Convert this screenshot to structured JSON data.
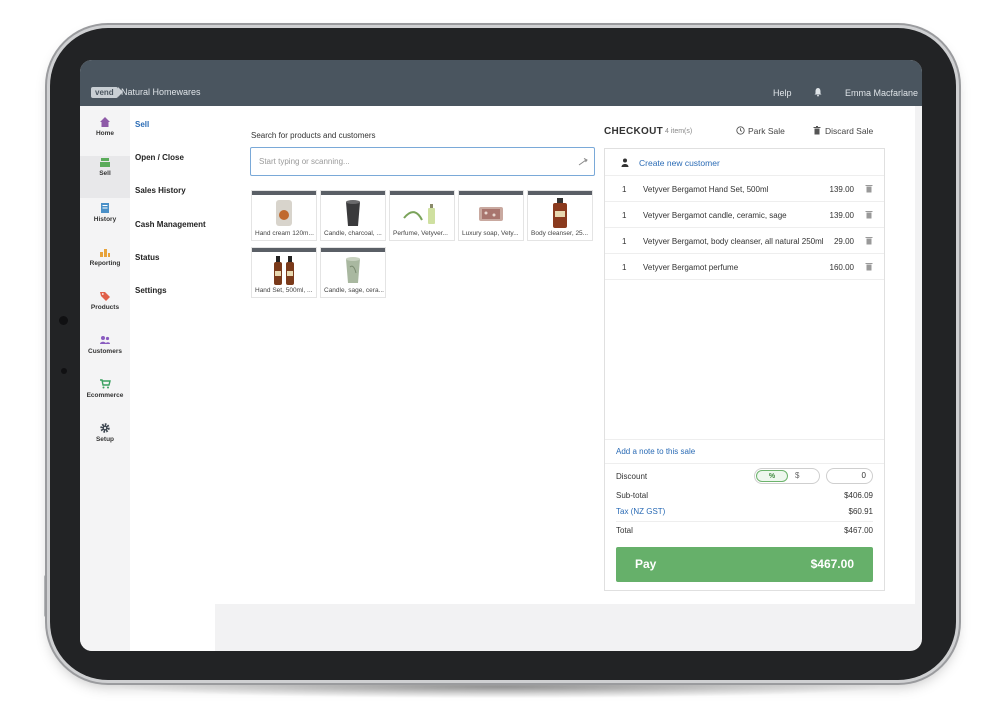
{
  "topbar": {
    "logo": "vend",
    "store_name": "Natural Homewares",
    "help": "Help",
    "user": "Emma Macfarlane"
  },
  "nav": [
    {
      "label": "Home",
      "icon": "home-icon"
    },
    {
      "label": "Sell",
      "icon": "register-icon"
    },
    {
      "label": "History",
      "icon": "history-icon"
    },
    {
      "label": "Reporting",
      "icon": "reporting-icon"
    },
    {
      "label": "Products",
      "icon": "tag-icon"
    },
    {
      "label": "Customers",
      "icon": "customers-icon"
    },
    {
      "label": "Ecommerce",
      "icon": "cart-icon"
    },
    {
      "label": "Setup",
      "icon": "gear-icon"
    }
  ],
  "subnav": [
    "Sell",
    "Open / Close",
    "Sales History",
    "Cash Management",
    "Status",
    "Settings"
  ],
  "search": {
    "label": "Search for products and customers",
    "placeholder": "Start typing or scanning..."
  },
  "products": [
    {
      "name": "Hand cream 120m..."
    },
    {
      "name": "Candle, charcoal, ..."
    },
    {
      "name": "Perfume, Vetyver..."
    },
    {
      "name": "Luxury soap, Vety..."
    },
    {
      "name": "Body cleanser, 25..."
    },
    {
      "name": "Hand Set, 500ml, ..."
    },
    {
      "name": "Candle, sage, cera..."
    }
  ],
  "checkout": {
    "title": "CHECKOUT",
    "item_count": "4 item(s)",
    "park": "Park Sale",
    "discard": "Discard Sale",
    "create_customer": "Create new customer",
    "lines": [
      {
        "qty": "1",
        "name": "Vetyver Bergamot Hand Set, 500ml",
        "price": "139.00"
      },
      {
        "qty": "1",
        "name": "Vetyver Bergamot candle, ceramic, sage",
        "price": "139.00"
      },
      {
        "qty": "1",
        "name": "Vetyver Bergamot, body cleanser, all natural 250ml",
        "price": "29.00"
      },
      {
        "qty": "1",
        "name": "Vetyver Bergamot perfume",
        "price": "160.00"
      }
    ],
    "note": "Add a note to this sale",
    "discount_label": "Discount",
    "discount_pct": "%",
    "discount_dollar": "$",
    "discount_value": "0",
    "subtotal_label": "Sub-total",
    "subtotal": "$406.09",
    "tax_label": "Tax (NZ GST)",
    "tax": "$60.91",
    "total_label": "Total",
    "total": "$467.00",
    "pay_label": "Pay",
    "pay_amount": "$467.00"
  },
  "colors": {
    "topbar": "#4a555f",
    "link": "#2a6bb5",
    "pay": "#66b06a"
  }
}
